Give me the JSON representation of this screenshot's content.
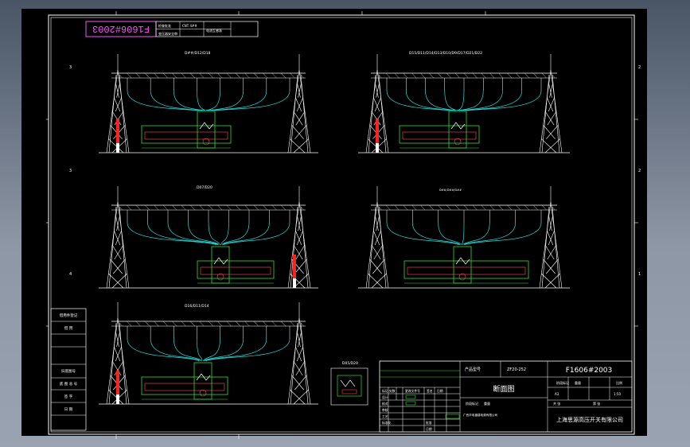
{
  "drawing_number": "F1606#2003",
  "stamp": {
    "top_label": "检查批准",
    "top_value": "CNT 4##",
    "bottom_label": "变压器安全审",
    "right_label": "电流互感表"
  },
  "views": [
    {
      "label": "D##/D12/D18"
    },
    {
      "label": "D15/D11/D14/D13/D10/D9/D17/D21/D22"
    },
    {
      "label": "D07/D20"
    },
    {
      "label": "D##/D##/D##"
    },
    {
      "label": "D16/D11/D14"
    }
  ],
  "detail_label": "D05/D20",
  "zone_marks": [
    "3",
    "3",
    "4",
    "2",
    "2",
    "1"
  ],
  "left_block": {
    "rows": [
      "借用件登记",
      "借  用",
      "旧底图号",
      "底 图 总 号",
      "签    字",
      "日    期"
    ]
  },
  "title_block": {
    "product_model_label": "产品型号",
    "product_model_value": "ZF20-252",
    "drawing_no": "F1606#2003",
    "drawing_title": "断面图",
    "stage_label": "阶段标记",
    "weight_label": "重量",
    "scale_label": "比例",
    "sheet_size": "A3",
    "scale_value": "1:50",
    "sheet_label": "共  张",
    "sheet_label_2": "第  张",
    "description": "广西华电福建电源有限公司",
    "company": "上海思源高压开关有限公司",
    "rev_header": [
      "标记",
      "处数",
      "更改文件号",
      "签名",
      "日期"
    ],
    "sign_rows": [
      "设计",
      "校对",
      "审核",
      "工艺",
      "标准化"
    ],
    "approve_label": "批准",
    "date_label": "日期"
  }
}
